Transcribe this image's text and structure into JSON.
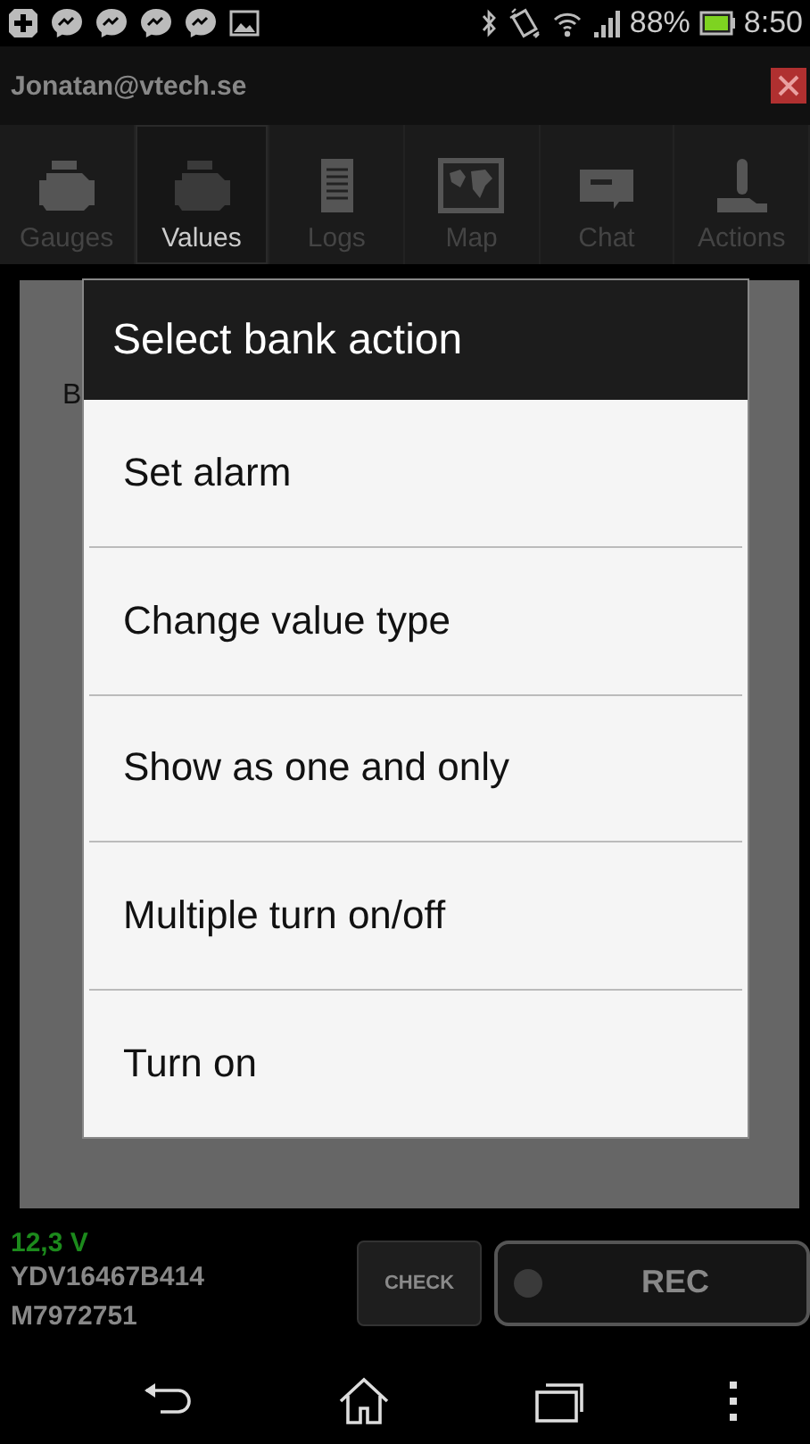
{
  "status_bar": {
    "battery_percent": "88%",
    "time": "8:50"
  },
  "account": {
    "email": "Jonatan@vtech.se"
  },
  "tabs": [
    {
      "label": "Gauges",
      "selected": false
    },
    {
      "label": "Values",
      "selected": true
    },
    {
      "label": "Logs",
      "selected": false
    },
    {
      "label": "Map",
      "selected": false
    },
    {
      "label": "Chat",
      "selected": false
    },
    {
      "label": "Actions",
      "selected": false
    }
  ],
  "background": {
    "cut_text": "B"
  },
  "dialog": {
    "title": "Select bank action",
    "items": [
      "Set alarm",
      "Change value type",
      "Show as one and only",
      "Multiple turn on/off",
      "Turn on"
    ]
  },
  "footer": {
    "voltage": "12,3 V",
    "vin": "YDV16467B414",
    "serial": "M7972751",
    "check_label": "CHECK",
    "rec_label": "REC"
  }
}
